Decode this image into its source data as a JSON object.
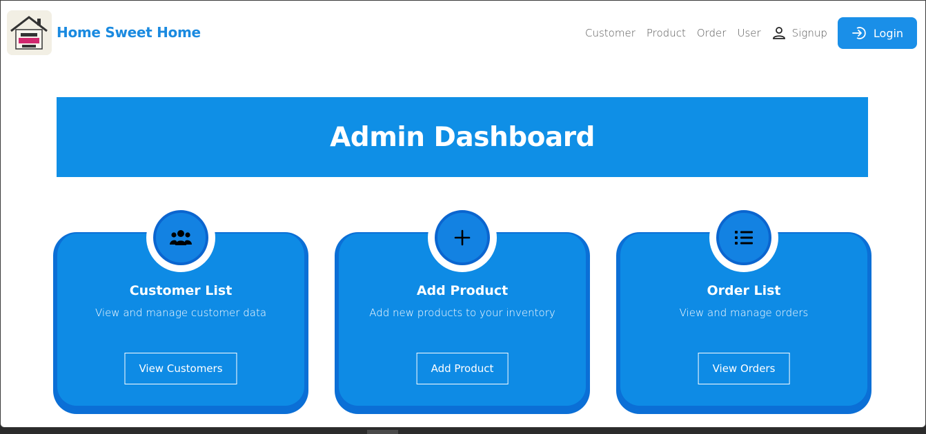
{
  "navbar": {
    "brand": "Home Sweet Home",
    "logo_icon": "house-logo-icon",
    "links": [
      "Customer",
      "Product",
      "Order",
      "User"
    ],
    "signup_label": "Signup",
    "signup_icon": "user-icon",
    "login_label": "Login",
    "login_icon": "login-icon"
  },
  "banner": {
    "title": "Admin Dashboard"
  },
  "cards": [
    {
      "icon": "users-icon",
      "title": "Customer List",
      "description": "View and manage customer data",
      "button": "View Customers"
    },
    {
      "icon": "plus-icon",
      "title": "Add Product",
      "description": "Add new products to your inventory",
      "button": "Add Product"
    },
    {
      "icon": "list-icon",
      "title": "Order List",
      "description": "View and manage orders",
      "button": "View Orders"
    }
  ],
  "colors": {
    "primary": "#0f8fe6",
    "card_border": "#0b6fd6",
    "brand_text": "#1a8ae0"
  }
}
